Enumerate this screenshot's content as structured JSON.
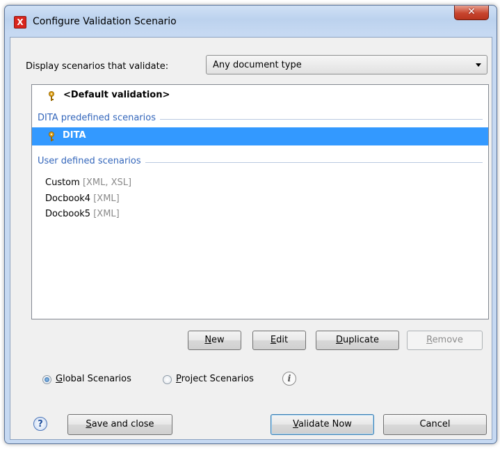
{
  "window": {
    "title": "Configure Validation Scenario",
    "close_glyph": "✕",
    "app_icon_glyph": "X"
  },
  "filter": {
    "label": "Display scenarios that validate:",
    "selected": "Any document type"
  },
  "list": {
    "default_item": "<Default validation>",
    "groups": [
      {
        "title": "DITA predefined scenarios",
        "items": [
          {
            "name": "DITA",
            "selected": true
          }
        ]
      },
      {
        "title": "User defined scenarios",
        "items": [
          {
            "name": "Custom",
            "tags": "[XML, XSL]"
          },
          {
            "name": "Docbook4",
            "tags": "[XML]"
          },
          {
            "name": "Docbook5",
            "tags": "[XML]"
          }
        ]
      }
    ]
  },
  "actions": {
    "new_mnemonic": "N",
    "new_rest": "ew",
    "edit_mnemonic": "E",
    "edit_rest": "dit",
    "duplicate_mnemonic": "D",
    "duplicate_rest": "uplicate",
    "remove_mnemonic": "R",
    "remove_rest": "emove"
  },
  "scope": {
    "global_mnemonic": "G",
    "global_rest": "lobal Scenarios",
    "project_mnemonic": "P",
    "project_rest": "roject Scenarios",
    "selected": "global",
    "info_glyph": "i"
  },
  "footer": {
    "help_glyph": "?",
    "save_mnemonic": "S",
    "save_rest": "ave and close",
    "validate_mnemonic": "V",
    "validate_rest": "alidate Now",
    "cancel_label": "Cancel"
  },
  "icons": {
    "key": "key-icon",
    "info": "info-icon",
    "help": "help-icon"
  },
  "colors": {
    "selection": "#3399ff",
    "group_header": "#3366bb",
    "tag": "#8a8a8a"
  }
}
